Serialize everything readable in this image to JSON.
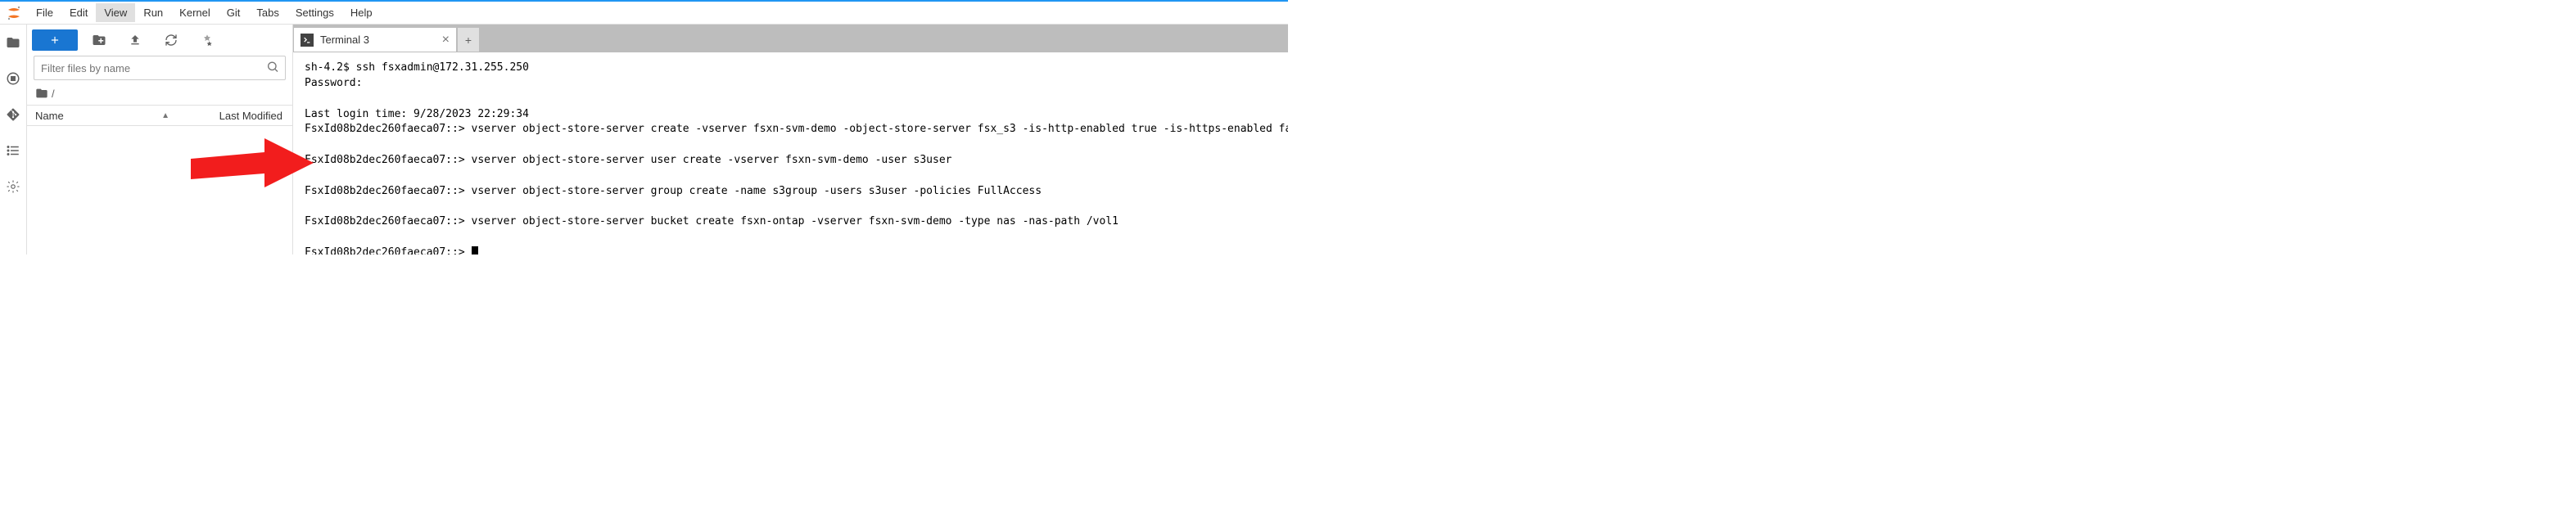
{
  "menu": {
    "items": [
      "File",
      "Edit",
      "View",
      "Run",
      "Kernel",
      "Git",
      "Tabs",
      "Settings",
      "Help"
    ],
    "active_index": 2
  },
  "sidebar": {
    "filter_placeholder": "Filter files by name",
    "breadcrumb": "/",
    "columns": {
      "name": "Name",
      "modified": "Last Modified"
    }
  },
  "tabs": [
    {
      "label": "Terminal 3",
      "icon": "terminal"
    }
  ],
  "terminal": {
    "lines": [
      "sh-4.2$ ssh fsxadmin@172.31.255.250",
      "Password:",
      "",
      "Last login time: 9/28/2023 22:29:34",
      "FsxId08b2dec260faeca07::> vserver object-store-server create -vserver fsxn-svm-demo -object-store-server fsx_s3 -is-http-enabled true -is-https-enabled false",
      "",
      "FsxId08b2dec260faeca07::> vserver object-store-server user create -vserver fsxn-svm-demo -user s3user",
      "",
      "FsxId08b2dec260faeca07::> vserver object-store-server group create -name s3group -users s3user -policies FullAccess",
      "",
      "FsxId08b2dec260faeca07::> vserver object-store-server bucket create fsxn-ontap -vserver fsxn-svm-demo -type nas -nas-path /vol1",
      "",
      "FsxId08b2dec260faeca07::> "
    ]
  }
}
